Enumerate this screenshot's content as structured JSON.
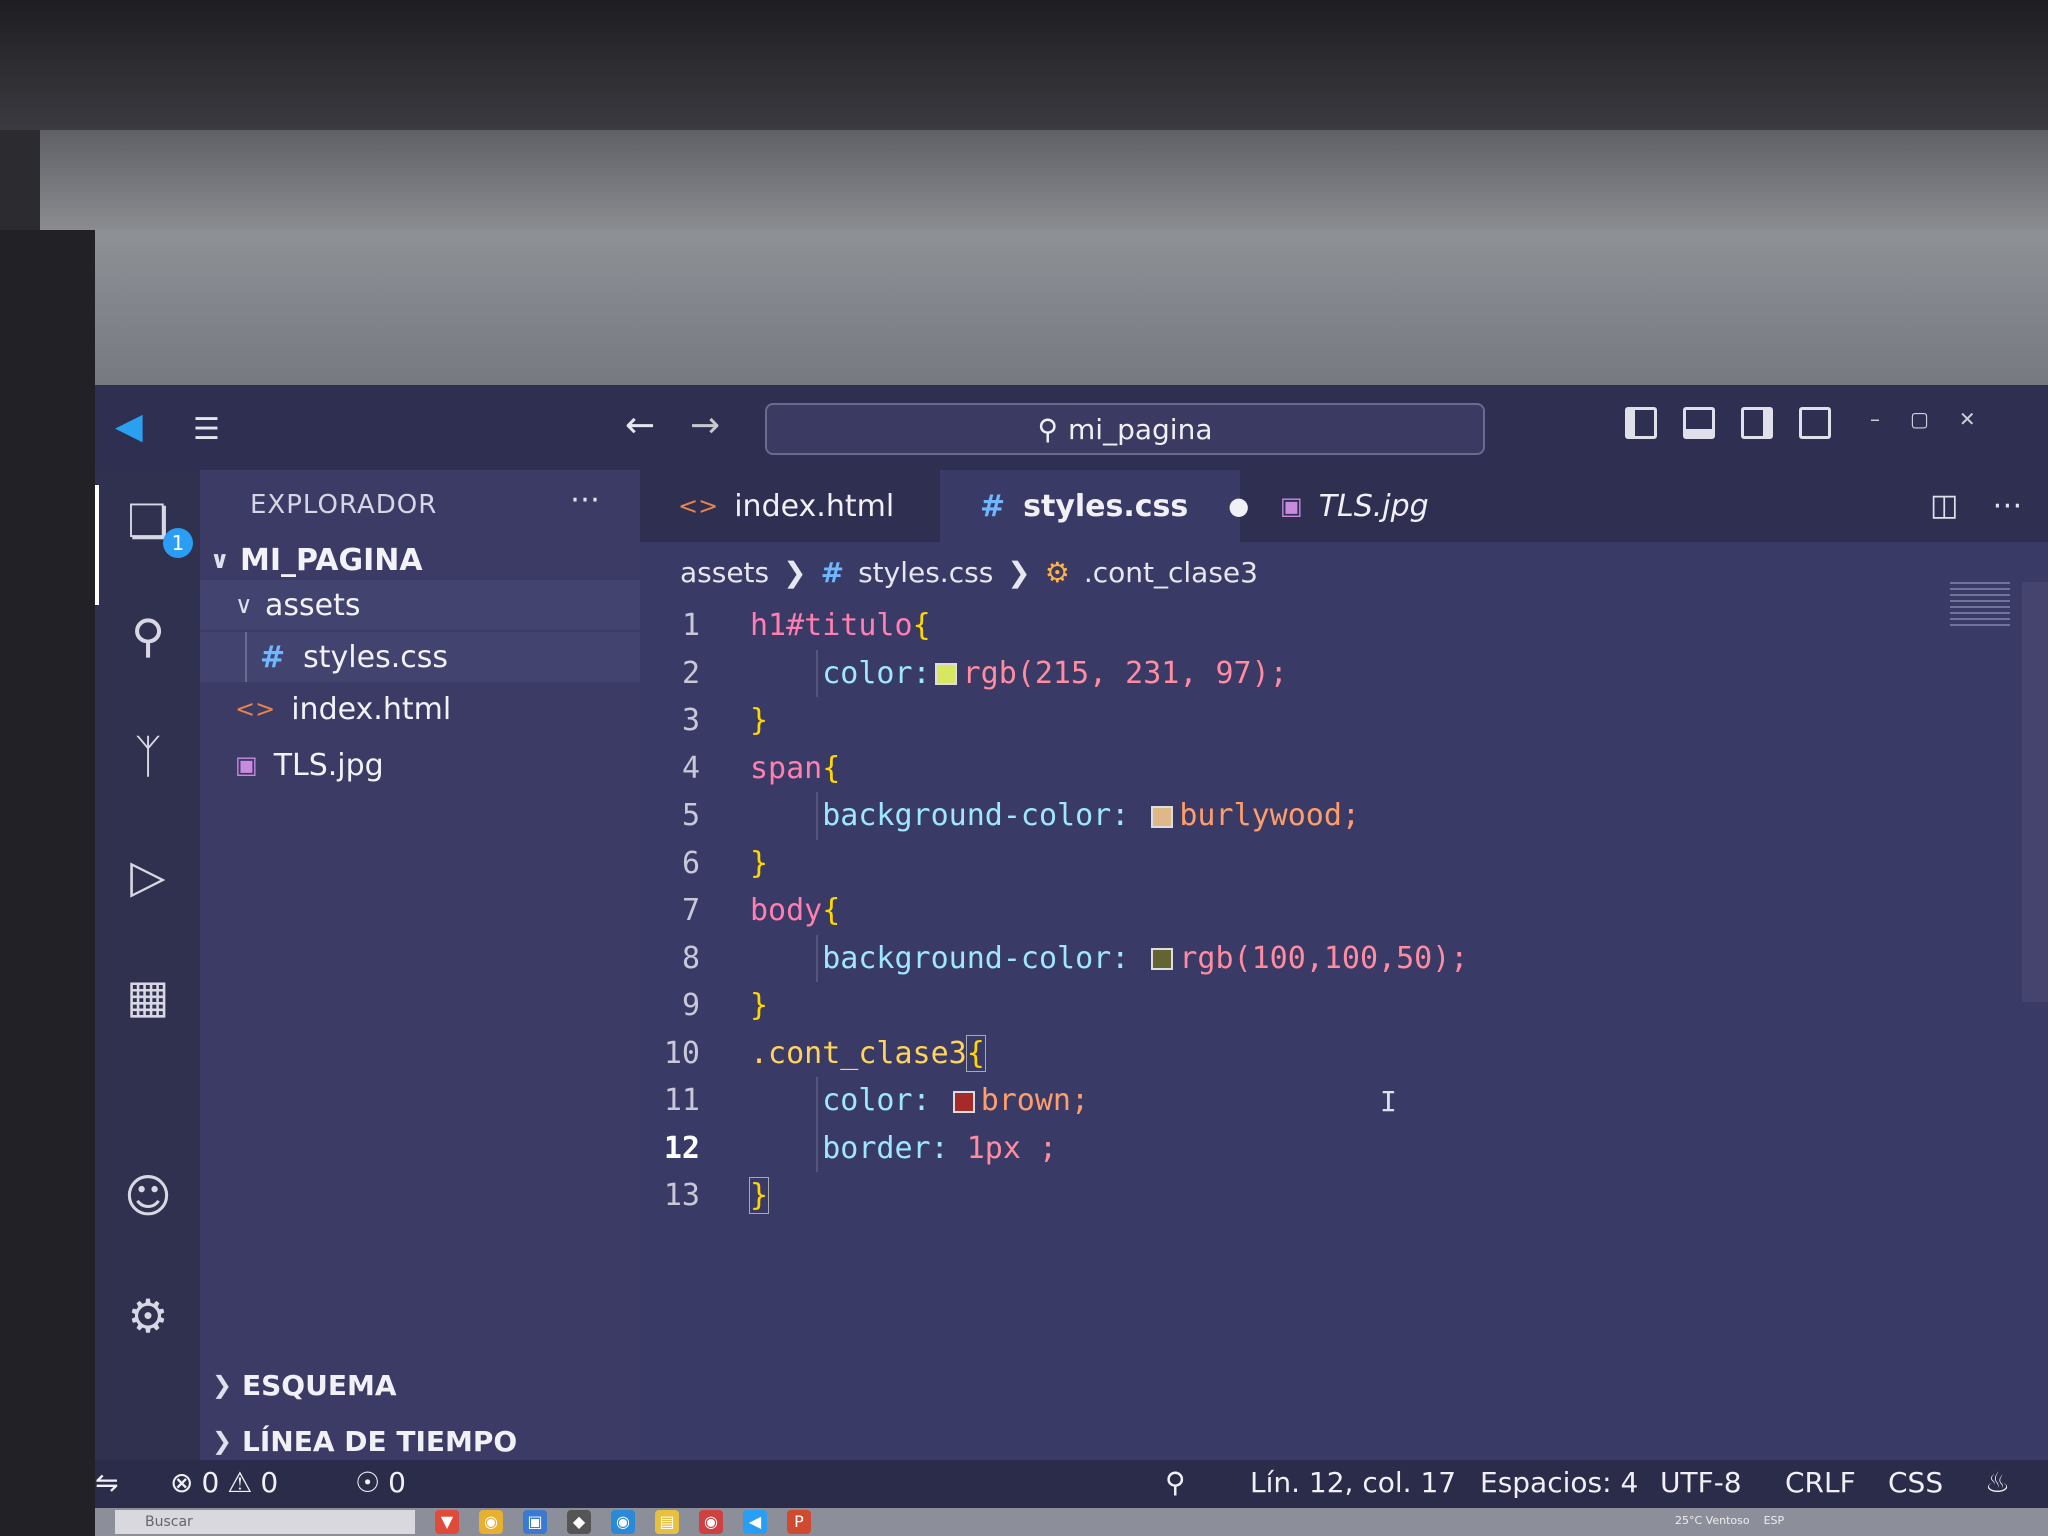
{
  "title": {
    "search": "mi_pagina"
  },
  "explorer": {
    "header": "EXPLORADOR",
    "root": "MI_PAGINA",
    "items": [
      {
        "label": "assets",
        "kind": "folder"
      },
      {
        "label": "styles.css",
        "kind": "css"
      },
      {
        "label": "index.html",
        "kind": "html"
      },
      {
        "label": "TLS.jpg",
        "kind": "image"
      }
    ],
    "sections": [
      "ESQUEMA",
      "LÍNEA DE TIEMPO"
    ],
    "badge": "1"
  },
  "tabs": [
    {
      "label": "index.html",
      "icon": "html-icon"
    },
    {
      "label": "styles.css",
      "icon": "css-icon",
      "modified": true
    },
    {
      "label": "TLS.jpg",
      "icon": "image-icon"
    }
  ],
  "breadcrumb": [
    "assets",
    "styles.css",
    ".cont_clase3"
  ],
  "code": {
    "line_numbers": [
      "1",
      "2",
      "3",
      "4",
      "5",
      "6",
      "7",
      "8",
      "9",
      "10",
      "11",
      "12",
      "13"
    ],
    "l1": {
      "sel": "h1#titulo",
      "brace": "{"
    },
    "l2": {
      "prop": "color:",
      "val": "rgb(215, 231, 97);",
      "swatch": "#d7e761"
    },
    "l3": {
      "brace": "}"
    },
    "l4": {
      "sel": "span",
      "brace": "{"
    },
    "l5": {
      "prop": "background-color:",
      "val": "burlywood;",
      "swatch": "#deb887"
    },
    "l6": {
      "brace": "}"
    },
    "l7": {
      "sel": "body",
      "brace": "{"
    },
    "l8": {
      "prop": "background-color:",
      "val": "rgb(100,100,50);",
      "swatch": "#646432"
    },
    "l9": {
      "brace": "}"
    },
    "l10": {
      "sel": ".cont_clase3",
      "brace": "{"
    },
    "l11": {
      "prop": "color:",
      "val": "brown;",
      "swatch": "#a52a2a"
    },
    "l12": {
      "prop": "border:",
      "val": "1px ;"
    },
    "l13": {
      "brace": "}"
    }
  },
  "status": {
    "errors": "0",
    "warnings": "0",
    "ports": "0",
    "position": "Lín. 12, col. 17",
    "spaces": "Espacios: 4",
    "encoding": "UTF-8",
    "eol": "CRLF",
    "language": "CSS"
  },
  "taskbar": {
    "search": "Buscar",
    "weather": "25°C Ventoso",
    "lang": "ESP"
  },
  "colors": {
    "accent": "#2a9df4",
    "editor_bg": "#3a3a66",
    "sidebar_bg": "#3b3b66"
  }
}
